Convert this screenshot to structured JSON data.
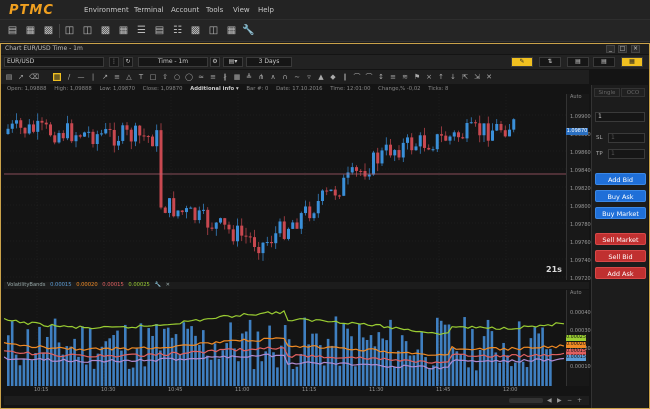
{
  "app": {
    "logo": "PTMC"
  },
  "menu": [
    "Environment",
    "Terminal",
    "Account",
    "Tools",
    "View",
    "Help"
  ],
  "toolbar_icons": [
    "chart-icon",
    "bars-icon",
    "chart-sheet-icon",
    "order-icon",
    "blotter-icon",
    "table-icon",
    "positions-icon",
    "list-icon",
    "sheet-icon",
    "news-icon",
    "ticker-icon",
    "account-icon",
    "stats-icon",
    "wrench-icon"
  ],
  "window": {
    "title": "Chart EUR/USD Time - 1m"
  },
  "controls": {
    "symbol": "EUR/USD",
    "timeframe": "Time - 1m",
    "range": "3 Days"
  },
  "info": {
    "open": "Open:  1,09888",
    "high": "High:  1,09888",
    "low": "Low:  1,09870",
    "close": "Close:  1,09870",
    "additional": "Additional info  ▾",
    "bar": "Bar #:  0",
    "date": "Date:  17.10.2016",
    "time": "Time:  12:01:00",
    "change": "Change,%  -0,02",
    "ticks": "Ticks:  8"
  },
  "price_axis": {
    "auto": "Auto",
    "labels": [
      "1.09900",
      "1.09880",
      "1.09860",
      "1.09840",
      "1.09820",
      "1.09800",
      "1.09780",
      "1.09760",
      "1.09740",
      "1.09720"
    ],
    "current": "1.09870"
  },
  "timer": "21s",
  "indicator": {
    "name": "VolatilityBands",
    "values": [
      "0.00015",
      "0.00020",
      "0.00015",
      "0.00025"
    ],
    "colors": [
      "#5b9bd5",
      "#f08a24",
      "#e06060",
      "#9acd32"
    ]
  },
  "sub_axis": {
    "auto": "Auto",
    "labels": [
      "0.00040",
      "0.00030",
      "0.00020",
      "0.00010"
    ],
    "tags": [
      "0.00025",
      "0.00020",
      "0.00015",
      "0.00015"
    ]
  },
  "time_labels": [
    "10:15",
    "10:30",
    "10:45",
    "11:00",
    "11:15",
    "11:30",
    "11:45",
    "12:00"
  ],
  "side": {
    "tabs": [
      "Single",
      "OCO"
    ],
    "quantity": "1",
    "sl_label": "SL",
    "tp_label": "TP",
    "sl_value": "1",
    "tp_value": "1",
    "buttons": {
      "add_bid": "Add Bid",
      "buy_ask": "Buy Ask",
      "buy_market": "Buy Market",
      "sell_market": "Sell Market",
      "sell_bid": "Sell Bid",
      "add_ask": "Add Ask"
    }
  },
  "colors": {
    "bull": "#3a8fd8",
    "bear": "#c84850",
    "accent": "#f0a020",
    "price_line": "#b06070"
  }
}
